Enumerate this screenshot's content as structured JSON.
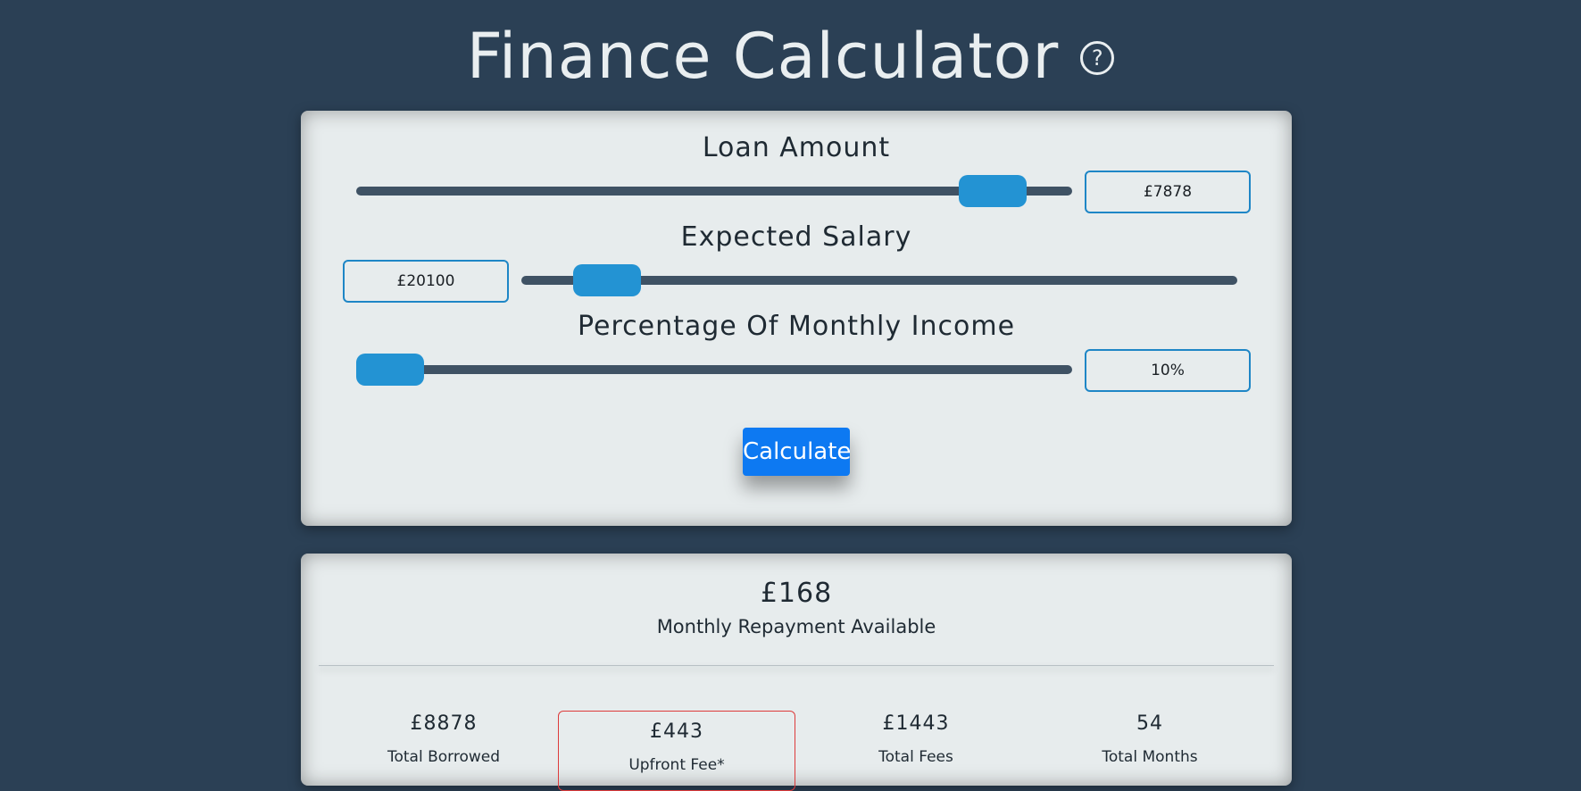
{
  "header": {
    "title": "Finance Calculator",
    "help_icon": "help-circle-icon",
    "help_glyph": "?"
  },
  "inputs": {
    "loan_amount": {
      "label": "Loan Amount",
      "value": "£7878",
      "slider_fraction": 0.93
    },
    "expected_salary": {
      "label": "Expected Salary",
      "value": "£20100",
      "slider_fraction": 0.08
    },
    "percentage_income": {
      "label": "Percentage Of Monthly Income",
      "value": "10%",
      "slider_fraction": 0.0
    },
    "calculate_label": "Calculate"
  },
  "results": {
    "monthly_amount": "£168",
    "monthly_label": "Monthly Repayment Available",
    "stats": [
      {
        "value": "£8878",
        "label": "Total Borrowed"
      },
      {
        "value": "£443",
        "label": "Upfront Fee*"
      },
      {
        "value": "£1443",
        "label": "Total Fees"
      },
      {
        "value": "54",
        "label": "Total Months"
      }
    ]
  },
  "colors": {
    "background": "#2b4055",
    "panel": "#e7eced",
    "slider_thumb": "#2393d3",
    "slider_track": "#3f5264",
    "button": "#0d79f2",
    "highlight_border": "#dd3b3b"
  }
}
